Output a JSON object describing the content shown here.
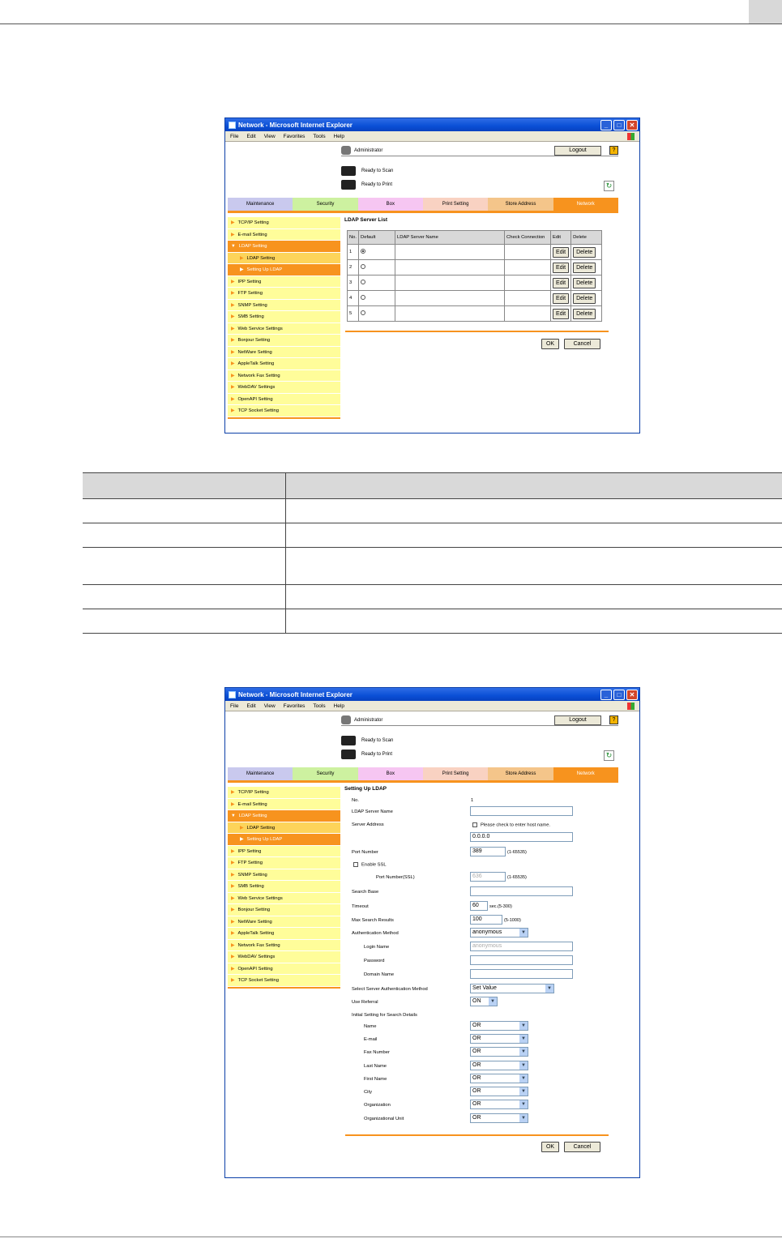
{
  "window": {
    "title": "Network - Microsoft Internet Explorer",
    "menu": [
      "File",
      "Edit",
      "View",
      "Favorites",
      "Tools",
      "Help"
    ]
  },
  "header": {
    "user": "Administrator",
    "logout": "Logout",
    "help": "?",
    "status_scan": "Ready to Scan",
    "status_print": "Ready to Print"
  },
  "tabs": [
    "Maintenance",
    "Security",
    "Box",
    "Print Setting",
    "Store Address",
    "Network"
  ],
  "sidebar": {
    "items": [
      "TCP/IP Setting",
      "E-mail Setting",
      "LDAP Setting",
      "LDAP Setting",
      "Setting Up LDAP",
      "IPP Setting",
      "FTP Setting",
      "SNMP Setting",
      "SMB Setting",
      "Web Service Settings",
      "Bonjour Setting",
      "NetWare Setting",
      "AppleTalk Setting",
      "Network Fax Setting",
      "WebDAV Settings",
      "OpenAPI Setting",
      "TCP Socket Setting"
    ]
  },
  "list_screen": {
    "title": "LDAP Server List",
    "columns": [
      "No.",
      "Default",
      "LDAP Server Name",
      "Check Connection",
      "Edit",
      "Delete"
    ],
    "rows": [
      "1",
      "2",
      "3",
      "4",
      "5"
    ],
    "edit_label": "Edit",
    "delete_label": "Delete",
    "ok": "OK",
    "cancel": "Cancel"
  },
  "form_screen": {
    "title": "Setting Up LDAP",
    "no_label": "No.",
    "no_value": "1",
    "server_name_label": "LDAP Server Name",
    "server_address_label": "Server Address",
    "host_check_label": "Please check to enter host name.",
    "server_address_value": "0.0.0.0",
    "port_label": "Port Number",
    "port_value": "389",
    "port_hint": "(1-65535)",
    "ssl_label": "Enable SSL",
    "ssl_port_label": "Port Number(SSL)",
    "ssl_port_value": "636",
    "ssl_port_hint": "(1-65535)",
    "search_base_label": "Search Base",
    "timeout_label": "Timeout",
    "timeout_value": "60",
    "timeout_hint": "sec.(5-300)",
    "max_results_label": "Max Search Results",
    "max_results_value": "100",
    "max_results_hint": "(5-1000)",
    "auth_method_label": "Authentication Method",
    "auth_method_value": "anonymous",
    "login_label": "Login Name",
    "login_value": "anonymous",
    "password_label": "Password",
    "domain_label": "Domain Name",
    "server_auth_label": "Select Server Authentication Method",
    "server_auth_value": "Set Value",
    "referral_label": "Use Referral",
    "referral_value": "ON",
    "search_details_label": "Initial Setting for Search Details",
    "search_fields": [
      "Name",
      "E-mail",
      "Fax Number",
      "Last Name",
      "First Name",
      "City",
      "Organization",
      "Organizational Unit"
    ],
    "search_value": "OR",
    "ok": "OK",
    "cancel": "Cancel"
  }
}
